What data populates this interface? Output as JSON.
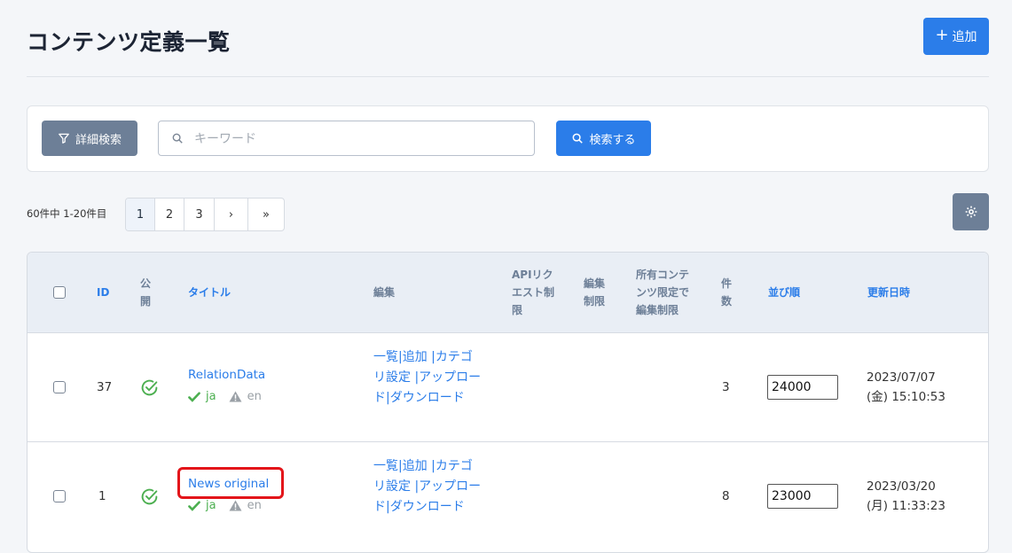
{
  "header": {
    "title": "コンテンツ定義一覧",
    "add_label": "追加"
  },
  "search": {
    "detail_label": "詳細検索",
    "placeholder": "キーワード",
    "submit_label": "検索する"
  },
  "pagination": {
    "summary": "60件中 1-20件目",
    "pages": [
      "1",
      "2",
      "3"
    ],
    "next": "›",
    "last": "»",
    "current": "1"
  },
  "table": {
    "columns": {
      "id": "ID",
      "public": "公開",
      "title": "タイトル",
      "edit": "編集",
      "api_restriction": "APIリクエスト制限",
      "edit_restriction": "編集制限",
      "owner_restriction": "所有コンテンツ限定で編集制限",
      "count": "件数",
      "order": "並び順",
      "updated": "更新日時"
    },
    "rows": [
      {
        "id": "37",
        "title": "RelationData",
        "lang_ja": "ja",
        "lang_en": "en",
        "edit_links": "一覧|追加 |カテゴリ設定 |アップロード|ダウンロード",
        "count": "3",
        "order": "24000",
        "updated_date": "2023/07/07",
        "updated_time": "(金) 15:10:53"
      },
      {
        "id": "1",
        "title": "News original",
        "lang_ja": "ja",
        "lang_en": "en",
        "edit_links": "一覧|追加 |カテゴリ設定 |アップロード|ダウンロード",
        "count": "8",
        "order": "23000",
        "updated_date": "2023/03/20",
        "updated_time": "(月) 11:33:23"
      }
    ]
  },
  "colors": {
    "primary": "#2b7de9",
    "secondary": "#6d7f97",
    "success": "#4caf50",
    "highlight": "#e3151a"
  }
}
